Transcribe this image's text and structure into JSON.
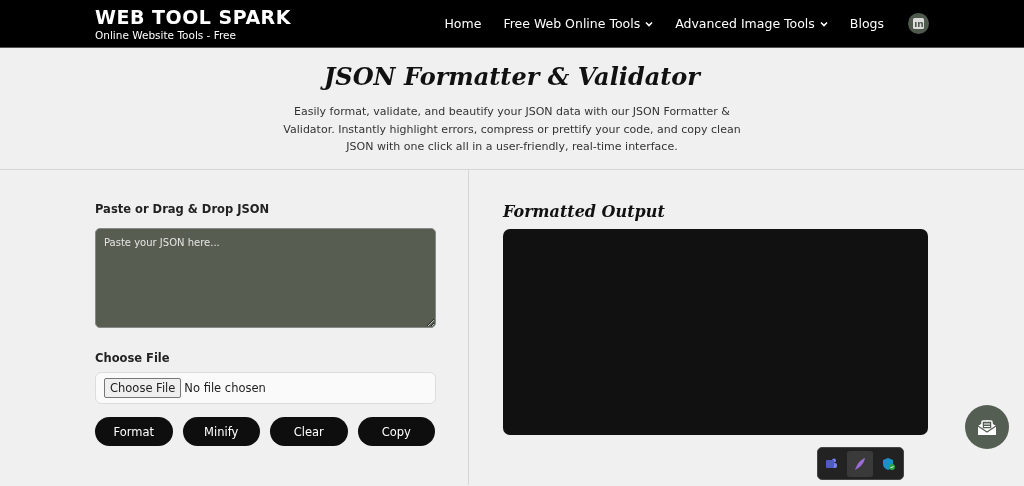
{
  "header": {
    "logo": "WEB TOOL SPARK",
    "tagline": "Online Website Tools - Free",
    "nav": [
      {
        "label": "Home",
        "dropdown": false
      },
      {
        "label": "Free Web Online Tools",
        "dropdown": true
      },
      {
        "label": "Advanced Image Tools",
        "dropdown": true
      },
      {
        "label": "Blogs",
        "dropdown": false
      }
    ]
  },
  "hero": {
    "title": "JSON Formatter & Validator",
    "description": "Easily format, validate, and beautify your JSON data with our JSON Formatter & Validator. Instantly highlight errors, compress or prettify your code, and copy clean JSON with one click all in a user-friendly, real-time interface."
  },
  "input": {
    "label": "Paste or Drag & Drop JSON",
    "placeholder": "Paste your JSON here...",
    "file_label": "Choose File",
    "file_button": "Choose File",
    "file_status": "No file chosen",
    "buttons": [
      "Format",
      "Minify",
      "Clear",
      "Copy"
    ]
  },
  "output": {
    "title": "Formatted Output"
  }
}
